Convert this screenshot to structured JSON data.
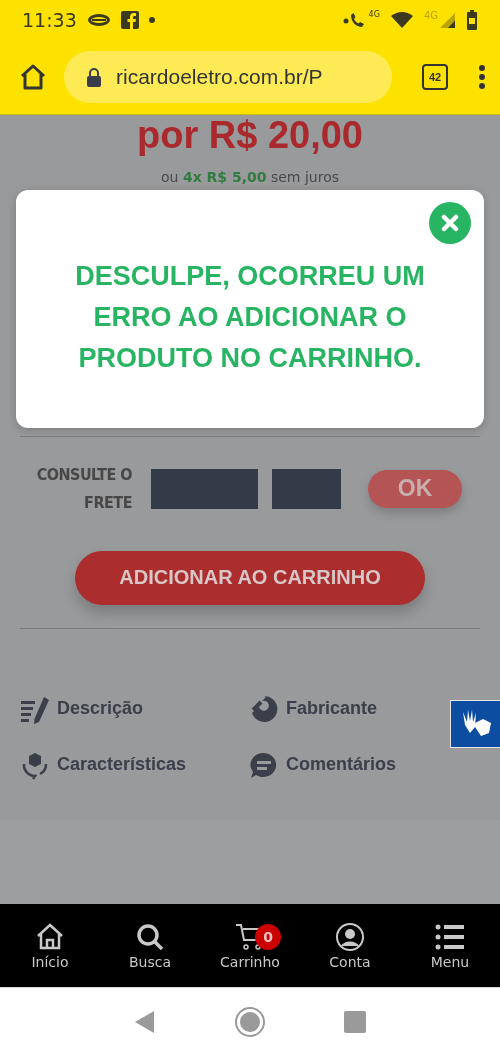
{
  "status_bar": {
    "time": "11:33",
    "call_network": "4G",
    "mobile_network": "4G"
  },
  "browser": {
    "url": "ricardoeletro.com.br/P",
    "tab_count": "42"
  },
  "product": {
    "price": "por R$ 20,00",
    "installments": "ou **4x R$ 5,00** sem juros"
  },
  "modal": {
    "message": "DESCULPE, OCORREU UM ERRO AO ADICIONAR O PRODUTO NO CARRINHO."
  },
  "shipping": {
    "label": "CONSULTE O FRETE",
    "button": "OK"
  },
  "add_to_cart": "ADICIONAR AO CARRINHO",
  "info_tabs": [
    {
      "label": "Descrição",
      "kind": "description"
    },
    {
      "label": "Fabricante",
      "kind": "maker"
    },
    {
      "label": "Características",
      "kind": "features"
    },
    {
      "label": "Comentários",
      "kind": "comments"
    }
  ],
  "bottom_nav": [
    {
      "label": "Início",
      "kind": "home"
    },
    {
      "label": "Busca",
      "kind": "search"
    },
    {
      "label": "Carrinho",
      "kind": "cart",
      "badge": "0"
    },
    {
      "label": "Conta",
      "kind": "account"
    },
    {
      "label": "Menu",
      "kind": "menu"
    }
  ]
}
